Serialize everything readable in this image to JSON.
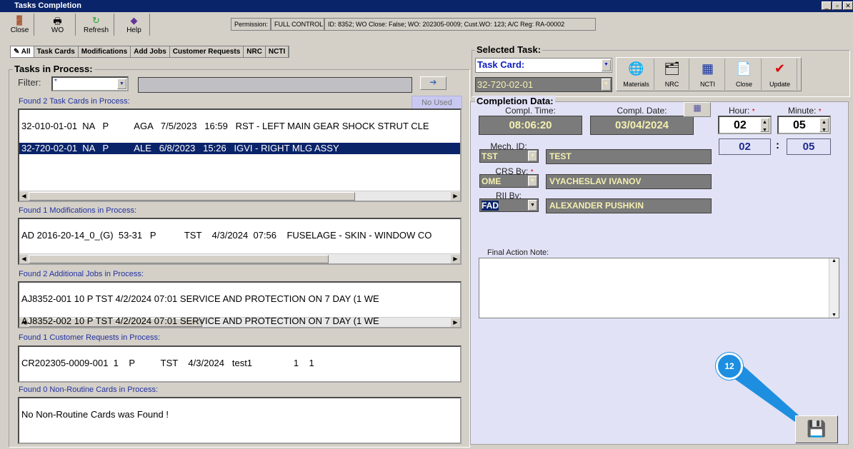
{
  "window": {
    "title": "Tasks Completion"
  },
  "toolbar": {
    "close": "Close",
    "wo": "WO",
    "refresh": "Refresh",
    "help": "Help",
    "permission_label": "Permission:",
    "permission_value": "FULL CONTROL",
    "info": "ID: 8352; WO Close: False; WO: 202305-0009; Cust.WO: 123; A/C Reg: RA-00002"
  },
  "tabs": [
    "All",
    "Task Cards",
    "Modifications",
    "Add Jobs",
    "Customer Requests",
    "NRC",
    "NCTI"
  ],
  "left": {
    "title": "Tasks in Process:",
    "filter_label": "Filter:",
    "filter_value": "*",
    "no_used": "No Used",
    "task_cards_label": "Found 2 Task Cards in Process:",
    "task_cards": [
      "32-010-01-01  NA   P          AGA   7/5/2023   16:59   RST - LEFT MAIN GEAR SHOCK STRUT CLE",
      "32-720-02-01  NA   P          ALE   6/8/2023   15:26   IGVI - RIGHT MLG ASSY"
    ],
    "mods_label": "Found 1 Modifications in Process:",
    "mods": [
      "AD 2016-20-14_0_(G)  53-31   P           TST    4/3/2024  07:56    FUSELAGE - SKIN - WINDOW CO"
    ],
    "jobs_label": "Found 2 Additional Jobs in Process:",
    "jobs": [
      "AJ8352-001  10    P          TST    4/2/2024  07:01   SERVICE AND PROTECTION ON 7 DAY (1 WE",
      "AJ8352-002  10    P          TST    4/2/2024  07:01   SERVICE AND PROTECTION ON 7 DAY (1 WE"
    ],
    "cr_label": "Found 1 Customer Requests in Process:",
    "cr": [
      "CR202305-0009-001  1    P          TST    4/3/2024   test1                1    1"
    ],
    "nrc_label": "Found 0 Non-Routine Cards in Process:",
    "nrc": [
      "No Non-Routine Cards was Found !"
    ]
  },
  "right": {
    "title": "Selected Task:",
    "type": "Task Card:",
    "task": "32-720-02-01",
    "buttons": [
      "Materials",
      "NRC",
      "NCTI",
      "Close",
      "Update"
    ],
    "completion_title": "Completion Data:",
    "compl_time_label": "Compl. Time:",
    "compl_time": "08:06:20",
    "compl_date_label": "Compl. Date:",
    "compl_date": "03/04/2024",
    "hour_label": "Hour:",
    "minute_label": "Minute:",
    "hour": "02",
    "minute": "05",
    "colon": ":",
    "mech_label": "Mech. ID:",
    "mech_code": "TST",
    "mech_name": "TEST",
    "crs_label": "CRS By:",
    "crs_code": "OME",
    "crs_name": "VYACHESLAV IVANOV",
    "rii_label": "RII By:",
    "rii_code": "FAD",
    "rii_name": "ALEXANDER PUSHKIN",
    "note_label": "Final Action Note:",
    "note": "",
    "required_mark": "*"
  },
  "callout": {
    "number": "12",
    "color": "#1e8fe0"
  }
}
